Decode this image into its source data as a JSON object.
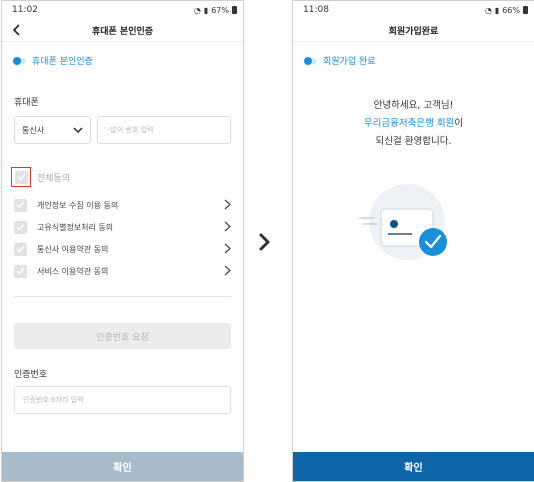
{
  "left": {
    "status": {
      "time": "11:02",
      "battery": "67%"
    },
    "title": "휴대폰 본인인증",
    "step_label": "휴대폰 본인인증",
    "phone_section_label": "휴대폰",
    "carrier_selected": "통신사",
    "phone_placeholder": "'-'없이 번호 입력",
    "agree_all_label": "전체동의",
    "terms": [
      {
        "label": "개인정보 수집 이용 동의"
      },
      {
        "label": "고유식별정보처리 동의"
      },
      {
        "label": "통신사 이용약관 동의"
      },
      {
        "label": "서비스 이용약관 동의"
      }
    ],
    "request_button": "인증번호 요청",
    "code_label": "인증번호",
    "code_placeholder": "인증번호 6자리 입력",
    "confirm_button": "확인"
  },
  "right": {
    "status": {
      "time": "11:08",
      "battery": "66%"
    },
    "title": "회원가입완료",
    "step_label": "회원가입 완료",
    "welcome_line1": "안녕하세요, 고객님!",
    "welcome_highlight": "우리금융저축은행 회원",
    "welcome_suffix": "이",
    "welcome_line3": "되신걸 환영합니다.",
    "confirm_button": "확인"
  },
  "colors": {
    "accent": "#1a8fd8",
    "confirm_disabled": "#a9bccb",
    "confirm_active": "#0e66a8",
    "highlight_border": "#d83a2c"
  },
  "icons": [
    "back-arrow-icon",
    "chevron-down-icon",
    "check-icon",
    "chevron-right-icon",
    "next-arrow-icon",
    "success-check-icon"
  ]
}
